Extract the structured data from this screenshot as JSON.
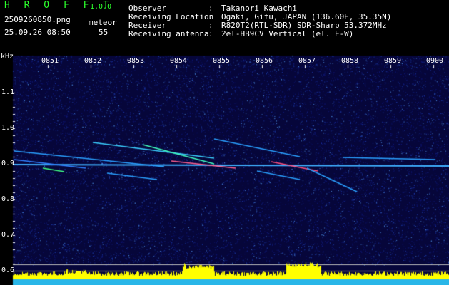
{
  "app": {
    "title": "H R O F F T",
    "version": "1.0.0"
  },
  "file_name": "2509260850.png",
  "datetime": "25.09.26 08:50",
  "meteor": {
    "label": "meteor",
    "count": "55"
  },
  "info": [
    {
      "key": "Observer",
      "value": "Takanori Kawachi"
    },
    {
      "key": "Receiving Location",
      "value": "Ogaki, Gifu, JAPAN (136.60E, 35.35N)"
    },
    {
      "key": "Receiver",
      "value": "R820T2(RTL-SDR) SDR-Sharp 53.372MHz"
    },
    {
      "key": "Receiving antenna",
      "value": "2el-HB9CV Vertical (el. E-W)"
    }
  ],
  "spectrogram": {
    "y_unit": "kHz",
    "time_ticks": [
      "0851",
      "0852",
      "0853",
      "0854",
      "0855",
      "0856",
      "0857",
      "0858",
      "0859",
      "0900"
    ],
    "freq_ticks": [
      "1.1",
      "1.0",
      "0.9",
      "0.8",
      "0.7",
      "0.6"
    ],
    "colors": {
      "background": "#0a0a5a",
      "signal": "#2aa0ff",
      "bar": "#ffff00",
      "accent": "#2cff2c"
    }
  }
}
